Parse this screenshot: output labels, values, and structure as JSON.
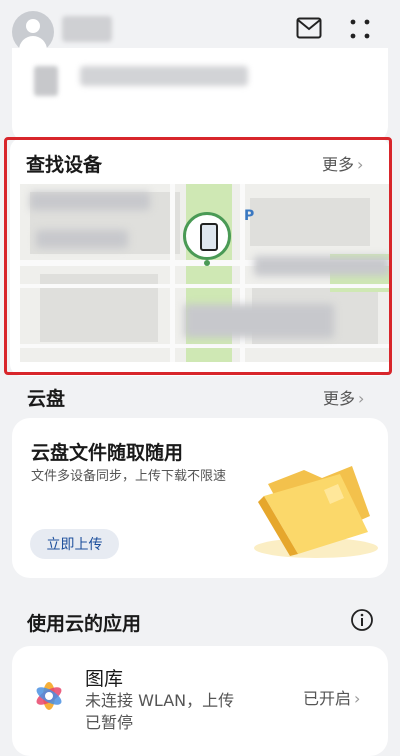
{
  "header": {
    "mail_icon": "mail-icon",
    "more_icon": "more-icon"
  },
  "find_device": {
    "title": "查找设备",
    "more": "更多",
    "chevron": "›",
    "map_poi": "P"
  },
  "cloud_drive": {
    "title": "云盘",
    "more": "更多",
    "chevron": "›",
    "card_title": "云盘文件随取随用",
    "card_desc": "文件多设备同步，上传下载不限速",
    "upload_button": "立即上传"
  },
  "cloud_apps": {
    "title": "使用云的应用",
    "info_icon": "info-icon",
    "gallery": {
      "name": "图库",
      "status": "未连接 WLAN，上传已暂停",
      "state": "已开启",
      "chevron": "›"
    }
  },
  "colors": {
    "highlight_frame": "#d8262b",
    "accent_green": "#4a9a55",
    "link_blue": "#1d4f9c"
  }
}
